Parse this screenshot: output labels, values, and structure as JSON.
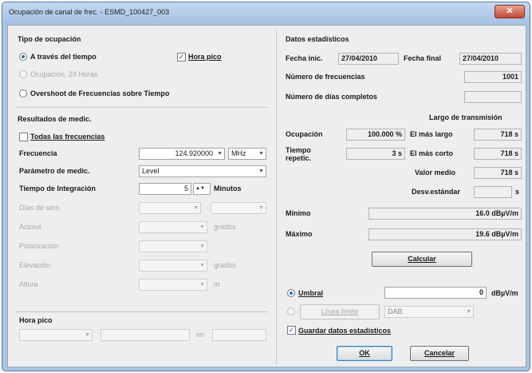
{
  "window": {
    "title": "Ocupación de canal de frec. - ESMD_100427_003",
    "close_glyph": "✕"
  },
  "tipo": {
    "heading": "Tipo de ocupación",
    "opt_tiempo": "A través del tiempo",
    "opt_24h": "Ocupación, 24 Horas",
    "opt_overshoot": "Overshoot de Frecuencias sobre Tiempo",
    "hora_pico_check": "Hora pico"
  },
  "resultados": {
    "heading": "Resultados de medic.",
    "todas_label": "Todas las frecuencias",
    "frecuencia_label": "Frecuencia",
    "frecuencia_value": "124.920000",
    "frecuencia_unit": "MHz",
    "parametro_label": "Parámetro de medic.",
    "parametro_value": "Level",
    "tiempo_label": "Tiempo de Integración",
    "tiempo_value": "5",
    "tiempo_unit": "Minutos",
    "dias_label": "Días de sem.",
    "acimut_label": "Acimut",
    "acimut_unit": "grados",
    "polarizacion_label": "Polarización",
    "elevacion_label": "Elevación",
    "elevacion_unit": "grados",
    "altura_label": "Altura",
    "altura_unit": "m",
    "hora_pico_heading": "Hora pico",
    "hora_sep": "en"
  },
  "datos": {
    "heading": "Datos estadísticos",
    "fecha_inic_label": "Fecha inic.",
    "fecha_inic_value": "27/04/2010",
    "fecha_final_label": "Fecha final",
    "fecha_final_value": "27/04/2010",
    "num_frec_label": "Número de frecuencias",
    "num_frec_value": "1001",
    "num_dias_label": "Número de días completos",
    "num_dias_value": "",
    "largo_heading": "Largo de transmisión",
    "ocupacion_label": "Ocupación",
    "ocupacion_value": "100.000 %",
    "mas_largo_label": "El más largo",
    "mas_largo_value": "718 s",
    "tiempo_repetic_label_1": "Tiempo",
    "tiempo_repetic_label_2": "repetic.",
    "tiempo_repetic_value": "3 s",
    "mas_corto_label": "El más corto",
    "mas_corto_value": "718 s",
    "valor_medio_label": "Valor medio",
    "valor_medio_value": "718 s",
    "desv_label": "Desv.estándar",
    "desv_unit": "s",
    "minimo_label": "Mínimo",
    "minimo_value": "16.0 dBµV/m",
    "maximo_label": "Máximo",
    "maximo_value": "19.6 dBµV/m",
    "calcular_label": "Calcular"
  },
  "umbral": {
    "umbral_label": "Umbral",
    "umbral_value": "0",
    "umbral_unit": "dBµV/m",
    "linea_limite_label": "Línea límite",
    "dab_value": "DAB",
    "guardar_label": "Guardar datos estadísticos"
  },
  "buttons": {
    "ok": "OK",
    "cancelar": "Cancelar"
  },
  "glyphs": {
    "check": "✓",
    "caret": "▼",
    "spin": "▲▼"
  },
  "colors": {
    "accent": "#2a6bd0",
    "title_bar": "#a9c4e4",
    "close_button": "#c44a34"
  }
}
